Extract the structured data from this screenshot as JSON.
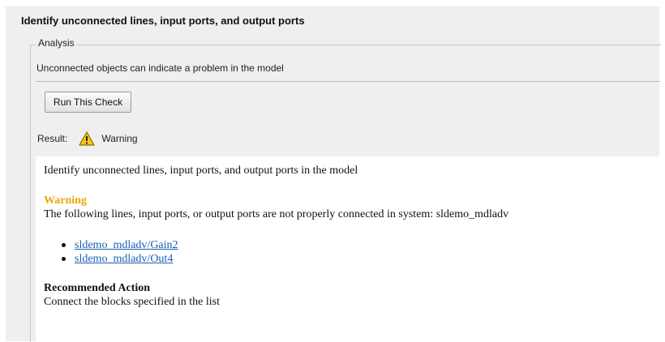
{
  "check": {
    "title": "Identify unconnected lines, input ports, and output ports",
    "analysis_legend": "Analysis",
    "description": "Unconnected objects can indicate a problem in the model",
    "run_button_label": "Run This Check",
    "result_label": "Result:",
    "result_status": "Warning",
    "result_icon": "warning-icon",
    "warning_color": "#f0a30a"
  },
  "report": {
    "intro": "Identify unconnected lines, input ports, and output ports in the model",
    "warning_title": "Warning",
    "warning_text": "The following lines, input ports, or output ports are not properly connected in system: sldemo_mdladv",
    "items": [
      {
        "label": "sldemo_mdladv/Gain2"
      },
      {
        "label": "sldemo_mdladv/Out4"
      }
    ],
    "recommended_title": "Recommended Action",
    "recommended_text": "Connect the blocks specified in the list"
  }
}
